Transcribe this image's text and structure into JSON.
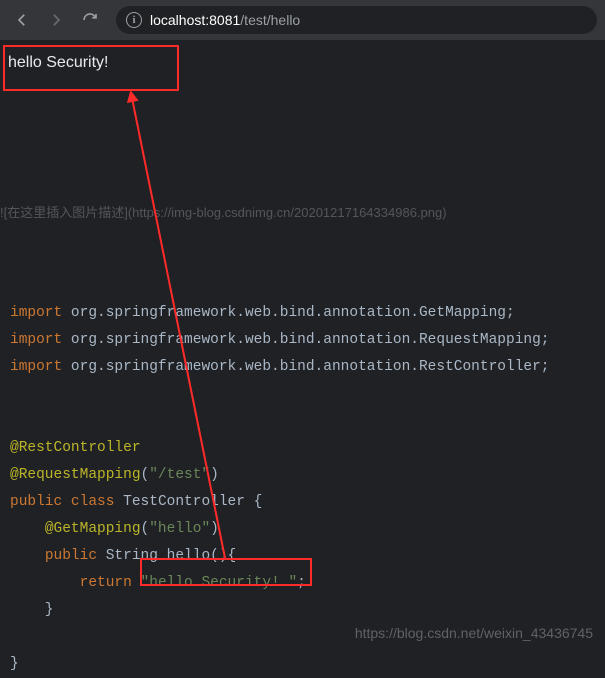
{
  "browser": {
    "url_host": "localhost:8081",
    "url_path": "/test/hello",
    "page_output": "hello Security!"
  },
  "faint_caption": "![在这里插入图片描述](https://img-blog.csdnimg.cn/20201217164334986.png)",
  "code": {
    "import_kw": "import",
    "imp1": " org.springframework.web.bind.annotation.GetMapping;",
    "imp2": " org.springframework.web.bind.annotation.RequestMapping;",
    "imp3": " org.springframework.web.bind.annotation.RestController;",
    "ann_rest": "@RestController",
    "ann_reqmap": "@RequestMapping",
    "reqmap_arg": "\"/test\"",
    "public_kw": "public",
    "class_kw": "class",
    "classname": " TestController {",
    "ann_get": "@GetMapping",
    "getmap_arg": "\"hello\"",
    "method_sig": " String hello(){",
    "return_kw": "return",
    "return_val": " \"hello Security! \"",
    "semicolon": ";",
    "close1": "    }",
    "close2": "}"
  },
  "watermark": "https://blog.csdn.net/weixin_43436745"
}
